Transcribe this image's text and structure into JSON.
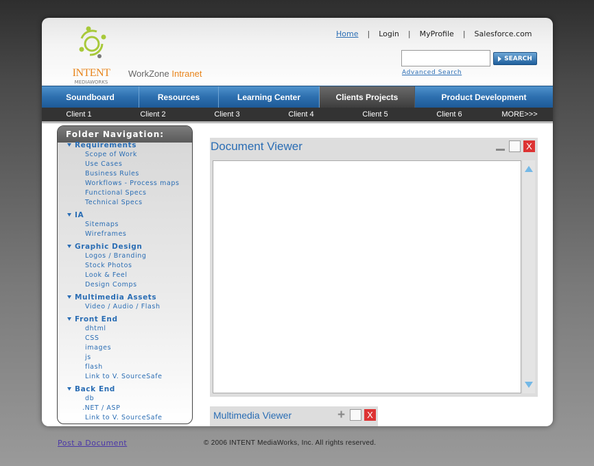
{
  "header": {
    "logo_name": "INTENT",
    "logo_sub": "MEDIAWORKS",
    "site_title": "WorkZone",
    "site_title_accent": "Intranet",
    "top_links": [
      "Home",
      "Login",
      "MyProfile",
      "Salesforce.com"
    ],
    "search": {
      "value": "",
      "button_label": "SEARCH",
      "advanced_label": "Advanced Search"
    }
  },
  "nav": {
    "tabs": [
      "Soundboard",
      "Resources",
      "Learning Center",
      "Clients Projects",
      "Product Development"
    ],
    "active_tab": "Clients Projects"
  },
  "subnav": {
    "clients": [
      "Client 1",
      "Client 2",
      "Client 3",
      "Client 4",
      "Client 5",
      "Client 6"
    ],
    "more": "MORE>>>"
  },
  "folder_nav": {
    "title": "Folder Navigation:",
    "groups": [
      {
        "label": "Requirements",
        "items": [
          "Scope of Work",
          "Use Cases",
          "Business Rules",
          "Workflows - Process maps",
          "Functional Specs",
          "Technical Specs"
        ]
      },
      {
        "label": "IA",
        "items": [
          "Sitemaps",
          "Wireframes"
        ]
      },
      {
        "label": "Graphic Design",
        "items": [
          "Logos / Branding",
          "Stock Photos",
          "Look & Feel",
          "Design Comps"
        ]
      },
      {
        "label": "Multimedia Assets",
        "items": [
          "Video / Audio / Flash"
        ]
      },
      {
        "label": "Front End",
        "items": [
          "dhtml",
          "CSS",
          "images",
          "js",
          "flash",
          "Link to V. SourceSafe"
        ]
      },
      {
        "label": "Back End",
        "items": [
          "db",
          ".NET / ASP",
          "Link to V. SourceSafe"
        ]
      }
    ]
  },
  "document_viewer": {
    "title": "Document Viewer",
    "close_label": "X"
  },
  "multimedia_viewer": {
    "title": "Multimedia Viewer",
    "plus_label": "+",
    "close_label": "X"
  },
  "footer": {
    "post_link": "Post a Document",
    "copyright": "© 2006 INTENT MediaWorks, Inc. All rights reserved."
  },
  "colors": {
    "brand_blue": "#2a6db4",
    "accent_orange": "#e8841a",
    "close_red": "#d33333"
  }
}
